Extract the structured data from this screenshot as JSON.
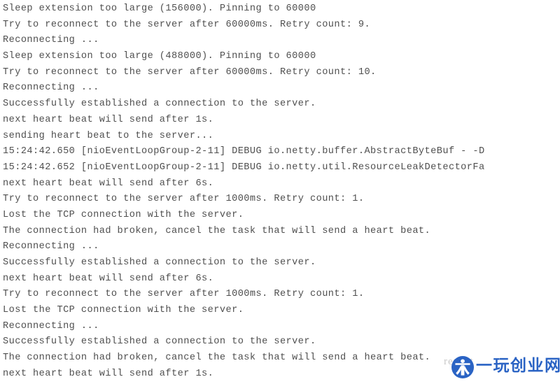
{
  "window": {
    "type": "console-log-output",
    "background_color": "#ffffff",
    "text_color": "#4f4f4f"
  },
  "log": {
    "lines": [
      "Sleep extension too large (156000). Pinning to 60000",
      "Try to reconnect to the server after 60000ms. Retry count: 9.",
      "Reconnecting ...",
      "Sleep extension too large (488000). Pinning to 60000",
      "Try to reconnect to the server after 60000ms. Retry count: 10.",
      "Reconnecting ...",
      "Successfully established a connection to the server.",
      "next heart beat will send after 1s.",
      "sending heart beat to the server...",
      "15:24:42.650 [nioEventLoopGroup-2-11] DEBUG io.netty.buffer.AbstractByteBuf - -D",
      "15:24:42.652 [nioEventLoopGroup-2-11] DEBUG io.netty.util.ResourceLeakDetectorFa",
      "next heart beat will send after 6s.",
      "Try to reconnect to the server after 1000ms. Retry count: 1.",
      "Lost the TCP connection with the server.",
      "The connection had broken, cancel the task that will send a heart beat.",
      "Reconnecting ...",
      "Successfully established a connection to the server.",
      "next heart beat will send after 6s.",
      "Try to reconnect to the server after 1000ms. Retry count: 1.",
      "Lost the TCP connection with the server.",
      "Reconnecting ...",
      "Successfully established a connection to the server.",
      "The connection had broken, cancel the task that will send a heart beat.",
      "next heart beat will send after 1s."
    ]
  },
  "watermark": {
    "ghost_text": "repeat",
    "brand_text": "一玩创业网",
    "emblem_name": "circular-figure-emblem",
    "color": "#2a63c4"
  }
}
